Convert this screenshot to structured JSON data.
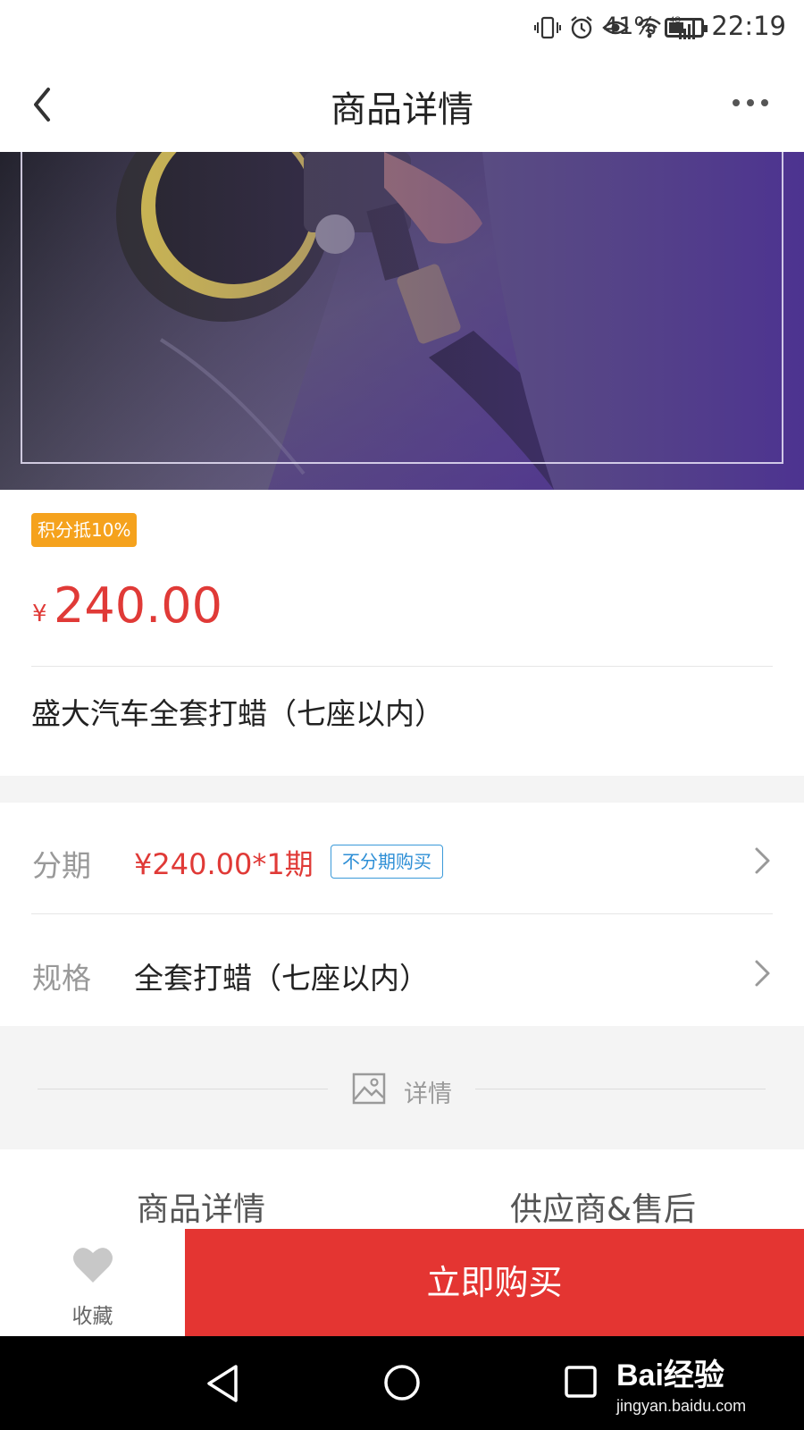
{
  "status_bar": {
    "battery_percent": "41%",
    "time": "22:19",
    "network": "4G",
    "icons": [
      "vibrate-icon",
      "alarm-icon",
      "eye-icon",
      "wifi-icon",
      "signal-icon",
      "battery-icon"
    ]
  },
  "nav": {
    "title": "商品详情",
    "back_icon": "chevron-left-icon",
    "more_icon": "more-dots-icon"
  },
  "product": {
    "points_badge": "积分抵10%",
    "currency_symbol": "¥",
    "price": "240.00",
    "name": "盛大汽车全套打蜡（七座以内）"
  },
  "installment": {
    "label": "分期",
    "value": "¥240.00*1期",
    "tag": "不分期购买"
  },
  "spec": {
    "label": "规格",
    "value": "全套打蜡（七座以内）"
  },
  "detail_section": {
    "label": "详情"
  },
  "tabs": [
    {
      "label": "商品详情"
    },
    {
      "label": "供应商&售后"
    }
  ],
  "action_bar": {
    "favorite_label": "收藏",
    "buy_label": "立即购买"
  },
  "watermark": {
    "brand": "Bai经验",
    "url": "jingyan.baidu.com"
  },
  "colors": {
    "price_red": "#e03a37",
    "buy_button": "#e43532",
    "badge_orange": "#f5a21d",
    "tag_blue": "#2e8fd6"
  }
}
